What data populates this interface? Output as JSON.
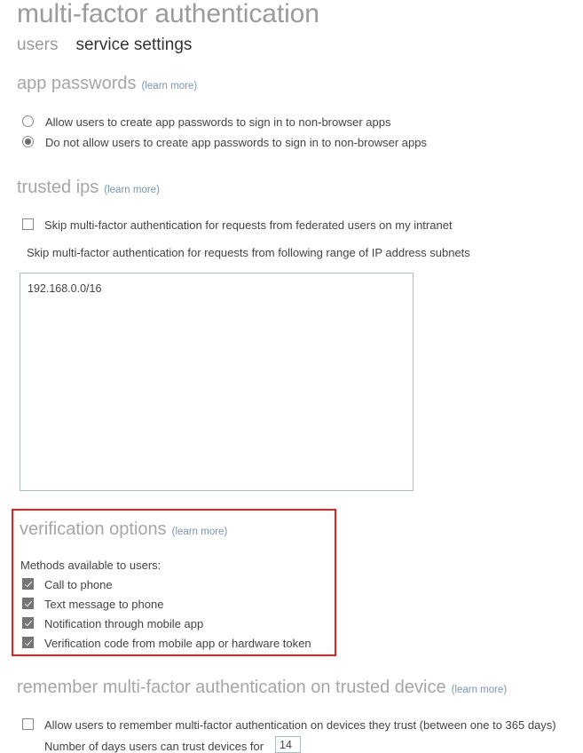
{
  "page": {
    "title": "multi-factor authentication"
  },
  "tabs": [
    {
      "label": "users",
      "active": false
    },
    {
      "label": "service settings",
      "active": true
    }
  ],
  "learn_more_label": "(learn more)",
  "sections": {
    "app_passwords": {
      "heading": "app passwords",
      "options": [
        {
          "label": "Allow users to create app passwords to sign in to non-browser apps",
          "checked": false
        },
        {
          "label": "Do not allow users to create app passwords to sign in to non-browser apps",
          "checked": true
        }
      ]
    },
    "trusted_ips": {
      "heading": "trusted ips",
      "federated_checkbox": {
        "label": "Skip multi-factor authentication for requests from federated users on my intranet",
        "checked": false
      },
      "subnets_label": "Skip multi-factor authentication for requests from following range of IP address subnets",
      "subnets_value": "192.168.0.0/16"
    },
    "verification_options": {
      "heading": "verification options",
      "methods_label": "Methods available to users:",
      "methods": [
        {
          "label": "Call to phone",
          "checked": true
        },
        {
          "label": "Text message to phone",
          "checked": true
        },
        {
          "label": "Notification through mobile app",
          "checked": true
        },
        {
          "label": "Verification code from mobile app or hardware token",
          "checked": true
        }
      ],
      "highlight_color": "#e8201f"
    },
    "remember_mfa": {
      "heading": "remember multi-factor authentication on trusted device",
      "allow_checkbox": {
        "label": "Allow users to remember multi-factor authentication on devices they trust (between one to 365 days)",
        "checked": false
      },
      "days_label": "Number of days users can trust devices for",
      "days_value": "14"
    }
  }
}
